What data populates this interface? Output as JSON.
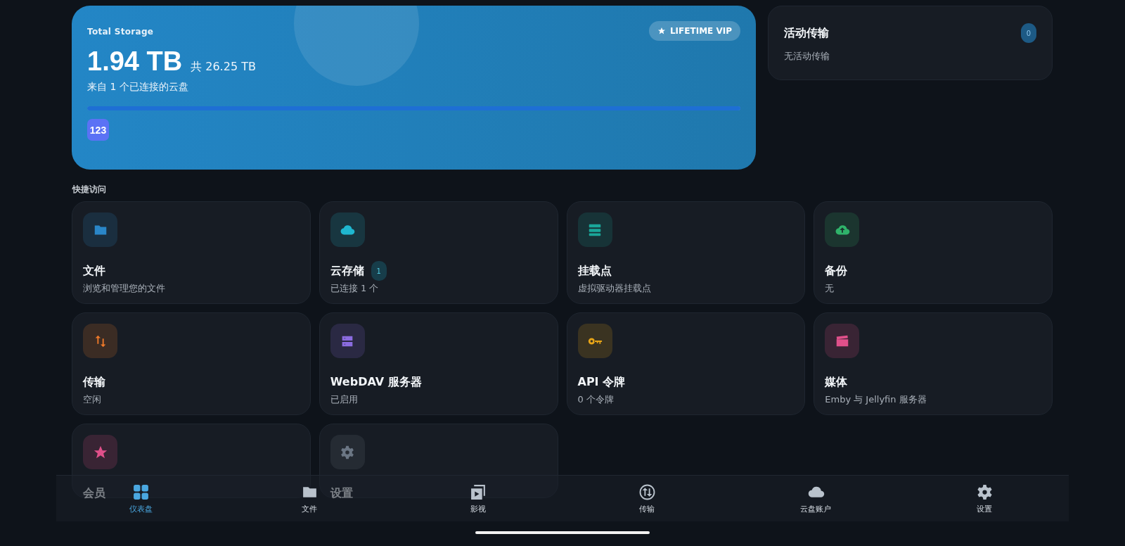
{
  "storage": {
    "label": "Total Storage",
    "used": "1.94 TB",
    "total": "共 26.25 TB",
    "source": "来自 1 个已连接的云盘",
    "badge": "LIFETIME VIP",
    "level": 1,
    "providers": [
      {
        "logo": "123"
      }
    ]
  },
  "active_transfers": {
    "title": "活动传输",
    "count": "0",
    "status": "无活动传输"
  },
  "quick_access": {
    "title": "快捷访问",
    "cards": [
      {
        "kind": "folder",
        "color": "#2a86c8",
        "title": "文件",
        "subtitle": "浏览和管理您的文件"
      },
      {
        "kind": "cloud",
        "color": "#1fb6cf",
        "title": "云存储",
        "badge": "1",
        "subtitle": "已连接 1 个"
      },
      {
        "kind": "server",
        "color": "#1aa79a",
        "title": "挂载点",
        "subtitle": "虚拟驱动器挂载点"
      },
      {
        "kind": "upload",
        "color": "#2fb36a",
        "title": "备份",
        "subtitle": "无"
      },
      {
        "kind": "transfer",
        "color": "#f07a2a",
        "title": "传输",
        "subtitle": "空闲"
      },
      {
        "kind": "webdav",
        "color": "#8b6ce0",
        "title": "WebDAV 服务器",
        "subtitle": "已启用"
      },
      {
        "kind": "key",
        "color": "#e8a517",
        "title": "API 令牌",
        "subtitle": "0 个令牌"
      },
      {
        "kind": "media",
        "color": "#e0508a",
        "title": "媒体",
        "subtitle": "Emby 与 Jellyfin 服务器"
      },
      {
        "kind": "star",
        "color": "#e0508a",
        "title": "会员"
      },
      {
        "kind": "gear",
        "color": "#6b7684",
        "title": "设置"
      }
    ]
  },
  "bottom_nav": [
    {
      "kind": "dashboard",
      "label": "仪表盘",
      "selected": true
    },
    {
      "kind": "folder",
      "label": "文件",
      "selected": false
    },
    {
      "kind": "video",
      "label": "影视",
      "selected": false
    },
    {
      "kind": "transfer",
      "label": "传输",
      "selected": false
    },
    {
      "kind": "cloud",
      "label": "云盘账户",
      "selected": false
    },
    {
      "kind": "gear",
      "label": "设置",
      "selected": false
    }
  ]
}
